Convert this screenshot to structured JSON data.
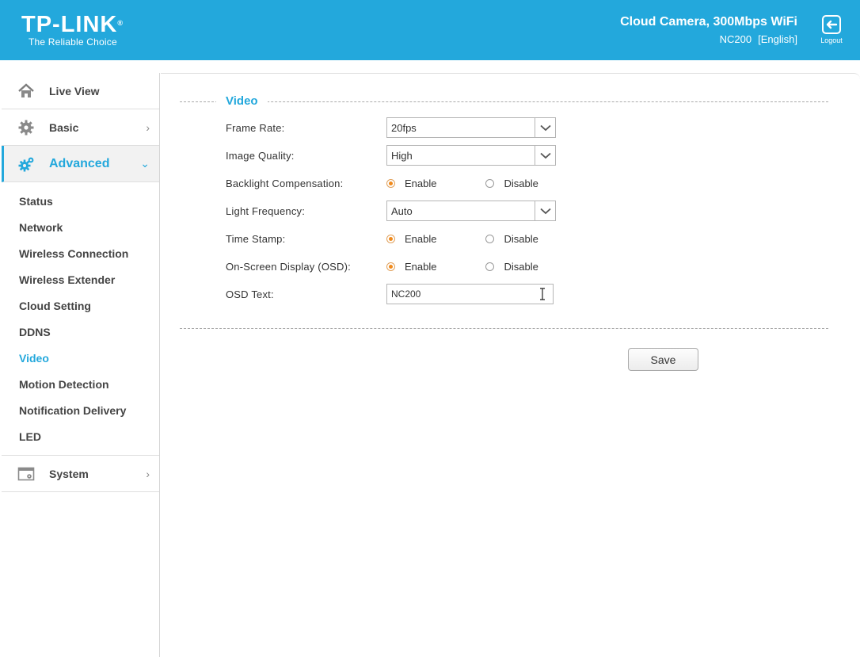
{
  "header": {
    "logo_text": "TP-LINK",
    "logo_mark": "®",
    "tagline": "The Reliable Choice",
    "product_name": "Cloud Camera, 300Mbps WiFi",
    "model": "NC200",
    "language": "[English]",
    "logout_label": "Logout",
    "bg_color": "#23a8dc"
  },
  "sidebar": {
    "main": [
      {
        "label": "Live View",
        "icon": "home-icon"
      },
      {
        "label": "Basic",
        "icon": "gear-icon"
      },
      {
        "label": "Advanced",
        "icon": "gears-icon",
        "expanded": true
      },
      {
        "label": "System",
        "icon": "system-window-icon"
      }
    ],
    "advanced_items": [
      "Status",
      "Network",
      "Wireless Connection",
      "Wireless Extender",
      "Cloud Setting",
      "DDNS",
      "Video",
      "Motion Detection",
      "Notification Delivery",
      "LED"
    ],
    "current_item": "Video"
  },
  "video": {
    "section_title": "Video",
    "frame_rate": {
      "label": "Frame Rate:",
      "value": "20fps"
    },
    "image_quality": {
      "label": "Image Quality:",
      "value": "High"
    },
    "backlight": {
      "label": "Backlight Compensation:",
      "enable": "Enable",
      "disable": "Disable",
      "selected": "Enable"
    },
    "light_frequency": {
      "label": "Light Frequency:",
      "value": "Auto"
    },
    "time_stamp": {
      "label": "Time Stamp:",
      "enable": "Enable",
      "disable": "Disable",
      "selected": "Enable"
    },
    "osd": {
      "label": "On-Screen Display (OSD):",
      "enable": "Enable",
      "disable": "Disable",
      "selected": "Enable"
    },
    "osd_text": {
      "label": "OSD Text:",
      "value": "NC200"
    },
    "save_label": "Save"
  },
  "colors": {
    "accent": "#23a8dc",
    "radio_selected": "#f08a1c"
  }
}
